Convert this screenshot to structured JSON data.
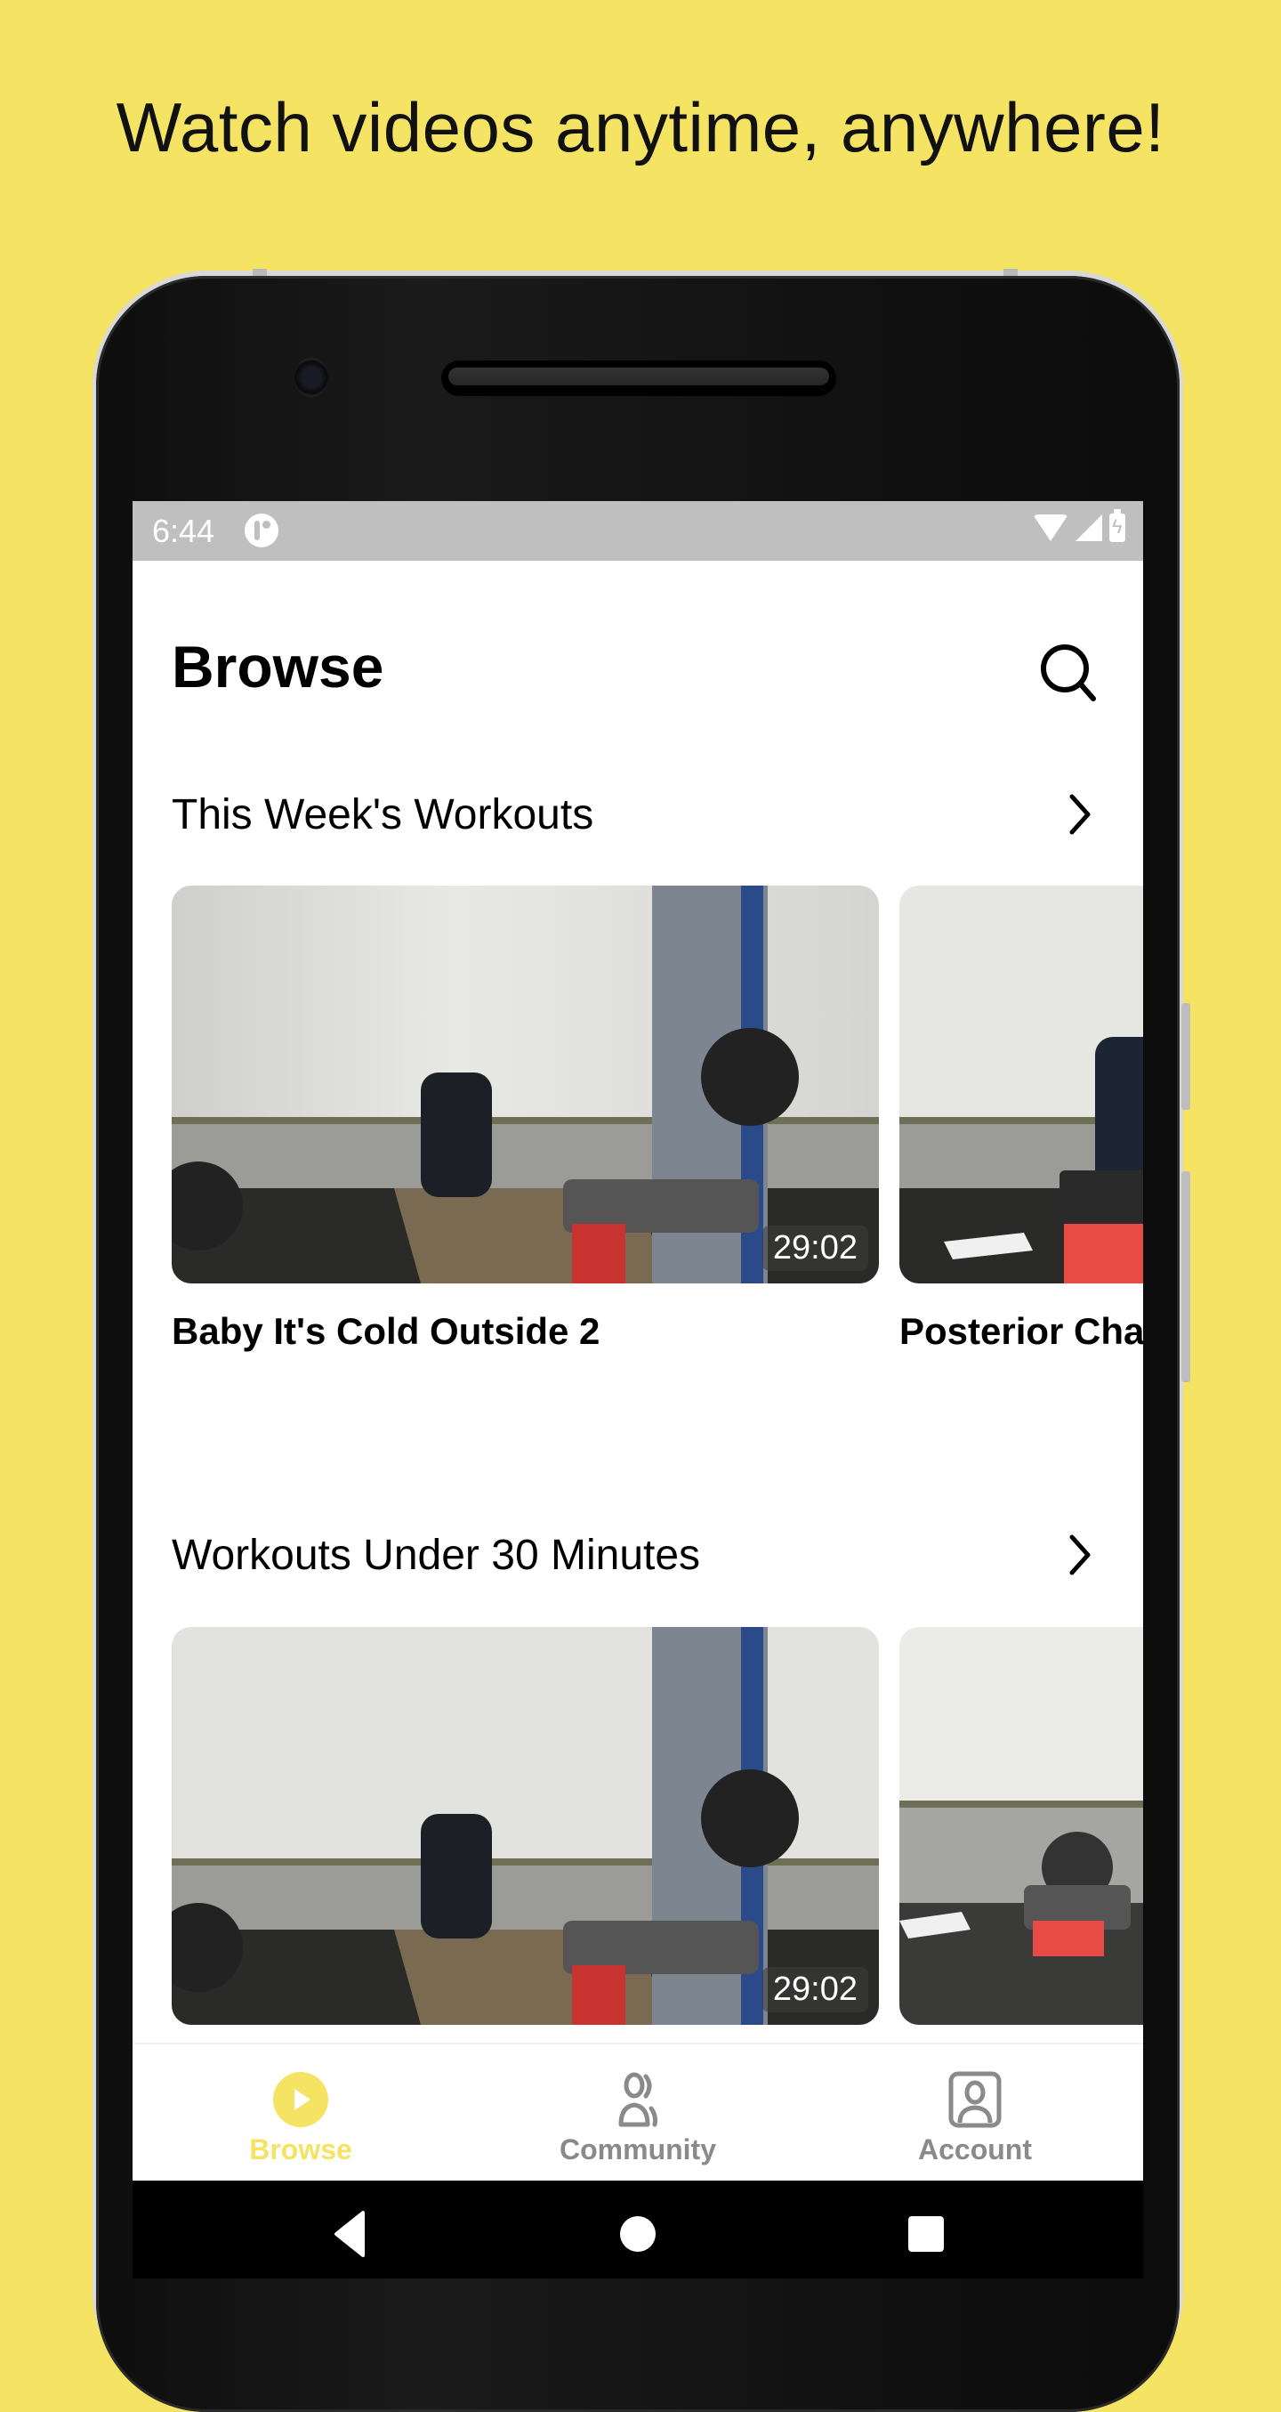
{
  "headline": "Watch videos anytime, anywhere!",
  "colors": {
    "background": "#F5E363",
    "accent": "#F5E363",
    "inactive_tab": "#8A8A8A",
    "status_bar": "#BFBFBF"
  },
  "status_bar": {
    "time": "6:44",
    "icons": [
      "app-notification-icon",
      "wifi-icon",
      "signal-icon",
      "battery-charging-icon"
    ]
  },
  "header": {
    "title": "Browse",
    "search_icon": "search-icon"
  },
  "sections": [
    {
      "title": "This Week's Workouts",
      "more_icon": "chevron-right-icon",
      "cards": [
        {
          "title": "Baby It's Cold Outside 2",
          "duration": "29:02"
        },
        {
          "title": "Posterior Cha",
          "duration": ""
        }
      ]
    },
    {
      "title": "Workouts Under 30 Minutes",
      "more_icon": "chevron-right-icon",
      "cards": [
        {
          "title": "",
          "duration": "29:02"
        },
        {
          "title": "",
          "duration": ""
        }
      ]
    }
  ],
  "tabbar": {
    "items": [
      {
        "label": "Browse",
        "icon": "play-circle-icon",
        "active": true
      },
      {
        "label": "Community",
        "icon": "users-icon",
        "active": false
      },
      {
        "label": "Account",
        "icon": "account-icon",
        "active": false
      }
    ]
  },
  "navbar": {
    "buttons": [
      "back-icon",
      "home-icon",
      "recents-icon"
    ]
  }
}
